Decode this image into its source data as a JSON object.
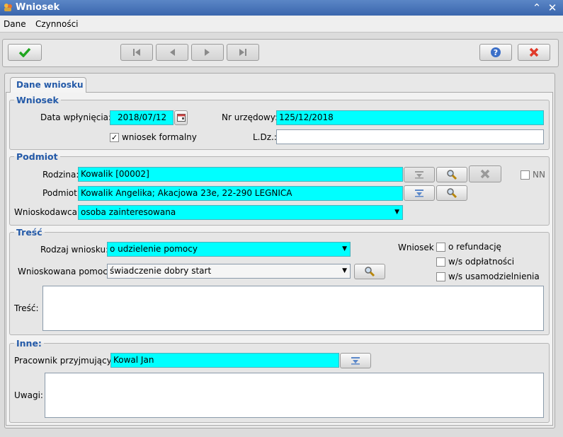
{
  "window": {
    "title": "Wniosek"
  },
  "menu": [
    {
      "label": "Dane"
    },
    {
      "label": "Czynności"
    }
  ],
  "toolbar": {
    "confirm_icon": "check-icon",
    "help_icon": "help-icon",
    "cancel_icon": "close-icon"
  },
  "tabs": [
    {
      "label": "Dane wniosku"
    }
  ],
  "wniosek": {
    "legend": "Wniosek",
    "data_label": "Data wpłynięcia:",
    "data_value": "2018/07/12",
    "nr_label": "Nr urzędowy:",
    "nr_value": "125/12/2018",
    "formalny_label": "wniosek formalny",
    "formalny_checked": true,
    "ldz_label": "L.Dz.:",
    "ldz_value": ""
  },
  "podmiot": {
    "legend": "Podmiot",
    "rodzina_label": "Rodzina:",
    "rodzina_value": "Kowalik [00002]",
    "nn_label": "NN",
    "podmiot_label": "Podmiot:",
    "podmiot_value": "Kowalik Angelika; Akacjowa 23e, 22-290 LEGNICA",
    "wnioskodawca_label": "Wnioskodawca:",
    "wnioskodawca_value": "osoba zainteresowana"
  },
  "tresc": {
    "legend": "Treść",
    "rodzaj_label": "Rodzaj wniosku:",
    "rodzaj_value": "o udzielenie pomocy",
    "pomoc_label": "Wnioskowana pomoc:",
    "pomoc_value": "świadczenie dobry start",
    "wniosek_label": "Wniosek",
    "opt1": "o refundację",
    "opt2": "w/s odpłatności",
    "opt3": "w/s usamodzielnienia",
    "tresc_label": "Treść:",
    "tresc_value": ""
  },
  "inne": {
    "legend": "Inne:",
    "pracownik_label": "Pracownik przyjmujący:",
    "pracownik_value": "Kowal Jan",
    "uwagi_label": "Uwagi:",
    "uwagi_value": ""
  }
}
